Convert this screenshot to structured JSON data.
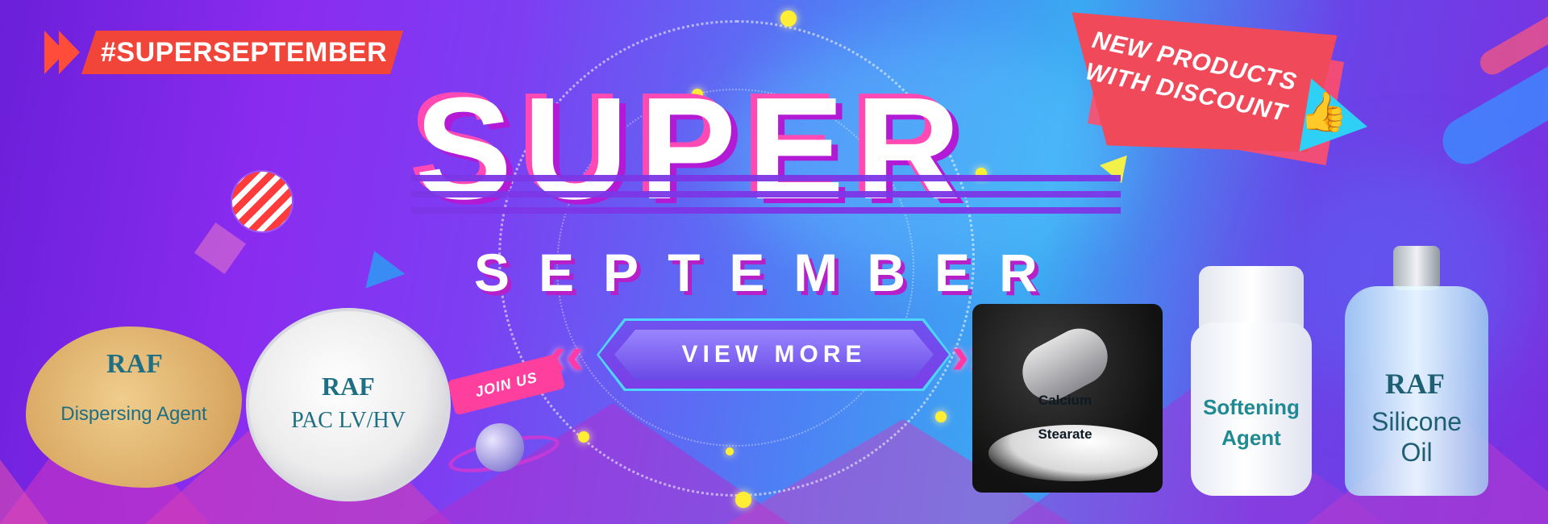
{
  "banner": {
    "hashtag": "#SUPERSEPTEMBER",
    "title_main": "SUPER",
    "title_sub": "SEPTEMBER",
    "cta_label": "VIEW MORE",
    "promo_line1": "NEW PRODUCTS",
    "promo_line2": "WITH DISCOUNT",
    "join_us": "JOIN US"
  },
  "products": [
    {
      "logo": "RAF",
      "name": "Dispersing Agent"
    },
    {
      "logo": "RAF",
      "name": "PAC LV/HV"
    },
    {
      "name_line1": "Calcium",
      "name_line2": "Stearate"
    },
    {
      "name_line1": "Softening",
      "name_line2": "Agent"
    },
    {
      "logo": "RAF",
      "name_line1": "Silicone",
      "name_line2": "Oil"
    }
  ],
  "colors": {
    "accent_red": "#f2453a",
    "accent_pink": "#ff3aa8",
    "accent_cyan": "#4fd6ff",
    "product_text": "#1f6f84"
  },
  "icons": [
    "thumbs-up-icon",
    "chevron-left-icon",
    "chevron-right-icon",
    "planet-icon",
    "striped-ball-icon"
  ]
}
